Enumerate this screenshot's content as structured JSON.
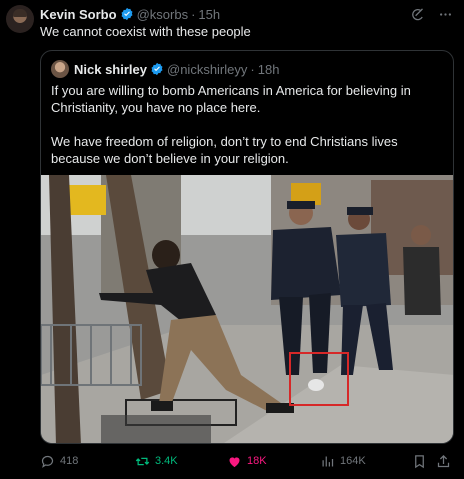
{
  "post": {
    "author_name": "Kevin Sorbo",
    "author_handle": "@ksorbs",
    "time": "15h",
    "text": "We cannot coexist with these people"
  },
  "quoted": {
    "author_name": "Nick shirley",
    "author_handle": "@nickshirleyy",
    "time": "18h",
    "paragraph1": "If you are willing to bomb Americans in America for believing in Christianity, you have no place here.",
    "paragraph2": "We have freedom of religion, don’t try to end Christians lives because we don’t believe in your religion."
  },
  "actions": {
    "replies": "418",
    "retweets": "3.4K",
    "likes": "18K",
    "views": "164K"
  },
  "icons": {
    "verified": "verified-badge-icon",
    "grok": "grok-icon",
    "more": "more-icon",
    "reply": "reply-icon",
    "retweet": "retweet-icon",
    "like": "heart-icon",
    "views": "views-icon",
    "bookmark": "bookmark-icon",
    "share": "share-icon"
  },
  "colors": {
    "background": "#000000",
    "text": "#e7e9ea",
    "muted": "#71767b",
    "verified": "#1d9bf0",
    "retweet": "#00ba7c",
    "like": "#f91880",
    "highlight_box": "#d62828"
  }
}
